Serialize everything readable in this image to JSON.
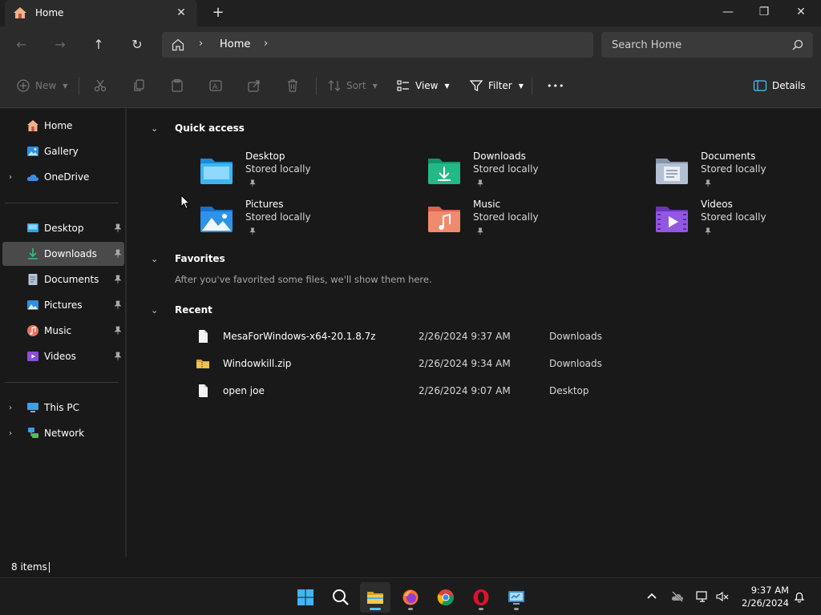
{
  "tab": {
    "title": "Home",
    "close_glyph": "✕",
    "new_glyph": "+"
  },
  "window": {
    "minimize_glyph": "—",
    "maximize_glyph": "❐",
    "close_glyph": "✕"
  },
  "address": {
    "crumb": "Home",
    "sep": "›",
    "search_placeholder": "Search Home"
  },
  "nav": {
    "back": "←",
    "forward": "→",
    "up": "↑",
    "refresh": "↻"
  },
  "commands": {
    "new": "New",
    "sort": "Sort",
    "view": "View",
    "filter": "Filter",
    "more": "•••",
    "details": "Details"
  },
  "sidebar": {
    "expander": "›",
    "pinned_top": [
      {
        "label": "Home",
        "icon": "home-icon"
      },
      {
        "label": "Gallery",
        "icon": "gallery-icon"
      },
      {
        "label": "OneDrive",
        "icon": "onedrive-icon"
      }
    ],
    "quick": [
      {
        "label": "Desktop",
        "icon": "desktop-folder-icon"
      },
      {
        "label": "Downloads",
        "icon": "downloads-folder-icon"
      },
      {
        "label": "Documents",
        "icon": "documents-folder-icon"
      },
      {
        "label": "Pictures",
        "icon": "pictures-folder-icon"
      },
      {
        "label": "Music",
        "icon": "music-folder-icon"
      },
      {
        "label": "Videos",
        "icon": "videos-folder-icon"
      }
    ],
    "bottom": [
      {
        "label": "This PC",
        "icon": "this-pc-icon"
      },
      {
        "label": "Network",
        "icon": "network-icon"
      }
    ]
  },
  "sections": {
    "chevron": "⌄",
    "quick_access": "Quick access",
    "favorites": "Favorites",
    "recent": "Recent",
    "favorites_empty": "After you've favorited some files, we'll show them here."
  },
  "quick_access": [
    {
      "name": "Desktop",
      "sub": "Stored locally"
    },
    {
      "name": "Downloads",
      "sub": "Stored locally"
    },
    {
      "name": "Documents",
      "sub": "Stored locally"
    },
    {
      "name": "Pictures",
      "sub": "Stored locally"
    },
    {
      "name": "Music",
      "sub": "Stored locally"
    },
    {
      "name": "Videos",
      "sub": "Stored locally"
    }
  ],
  "recent": [
    {
      "name": "MesaForWindows-x64-20.1.8.7z",
      "date": "2/26/2024 9:37 AM",
      "location": "Downloads",
      "icon": "file-icon"
    },
    {
      "name": "Windowkill.zip",
      "date": "2/26/2024 9:34 AM",
      "location": "Downloads",
      "icon": "zip-folder-icon"
    },
    {
      "name": "open joe",
      "date": "2/26/2024 9:07 AM",
      "location": "Desktop",
      "icon": "file-icon"
    }
  ],
  "status": {
    "items": "8 items"
  },
  "clock": {
    "time": "9:37 AM",
    "date": "2/26/2024"
  },
  "colors": {
    "accent": "#4cc2ff",
    "folder_yellow": "#f2c14e",
    "selection": "#4a4a4a"
  }
}
